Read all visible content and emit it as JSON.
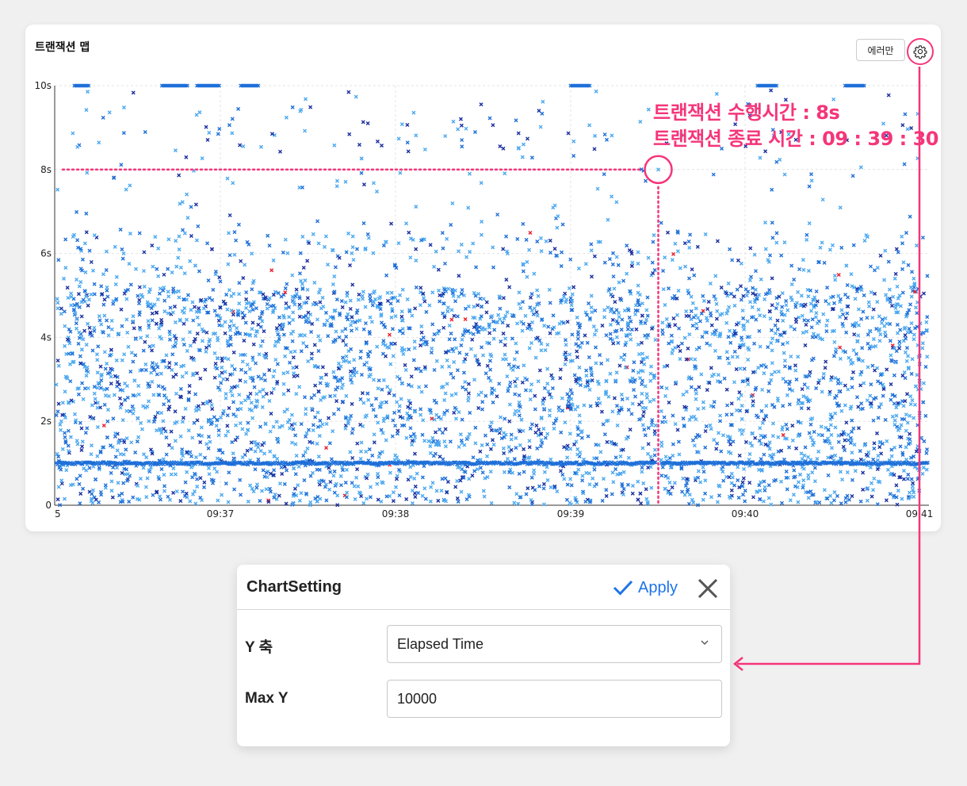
{
  "panel": {
    "title": "트랜잭션 맵",
    "error_only_label": "에러만",
    "settings_icon": "gear-icon"
  },
  "annotation": {
    "line1": "트랜잭션 수행시간 : 8s",
    "line2": "트랜잭션 종료 시간 : 09 : 39 : 30",
    "color": "#f5357a"
  },
  "chart_data": {
    "type": "scatter",
    "title": "",
    "xlabel": "",
    "ylabel": "",
    "y_ticks": [
      "0",
      "2s",
      "4s",
      "6s",
      "8s",
      "10s"
    ],
    "x_ticks": [
      "5",
      "09:37",
      "09:38",
      "09:39",
      "09:40",
      "09:41"
    ],
    "ylim": [
      0,
      10
    ],
    "grid": true,
    "marker": "x",
    "series_colors": [
      "#4aa8f0",
      "#1e6fd8",
      "#1a2fa0",
      "#e8202e"
    ],
    "highlighted_point": {
      "x": "09:39:30",
      "y": 8
    },
    "baseline_y": 1,
    "top_band_segments": [
      [
        "09:36:10",
        "09:36:15"
      ],
      [
        "09:36:40",
        "09:36:49"
      ],
      [
        "09:36:52",
        "09:37:00"
      ],
      [
        "09:37:07",
        "09:37:13"
      ],
      [
        "09:39:00",
        "09:39:07"
      ],
      [
        "09:40:04",
        "09:40:11"
      ],
      [
        "09:40:34",
        "09:40:41"
      ]
    ]
  },
  "dialog": {
    "title": "ChartSetting",
    "apply_label": "Apply",
    "y_axis_label": "Y 축",
    "y_axis_value": "Elapsed Time",
    "max_y_label": "Max Y",
    "max_y_value": "10000"
  }
}
